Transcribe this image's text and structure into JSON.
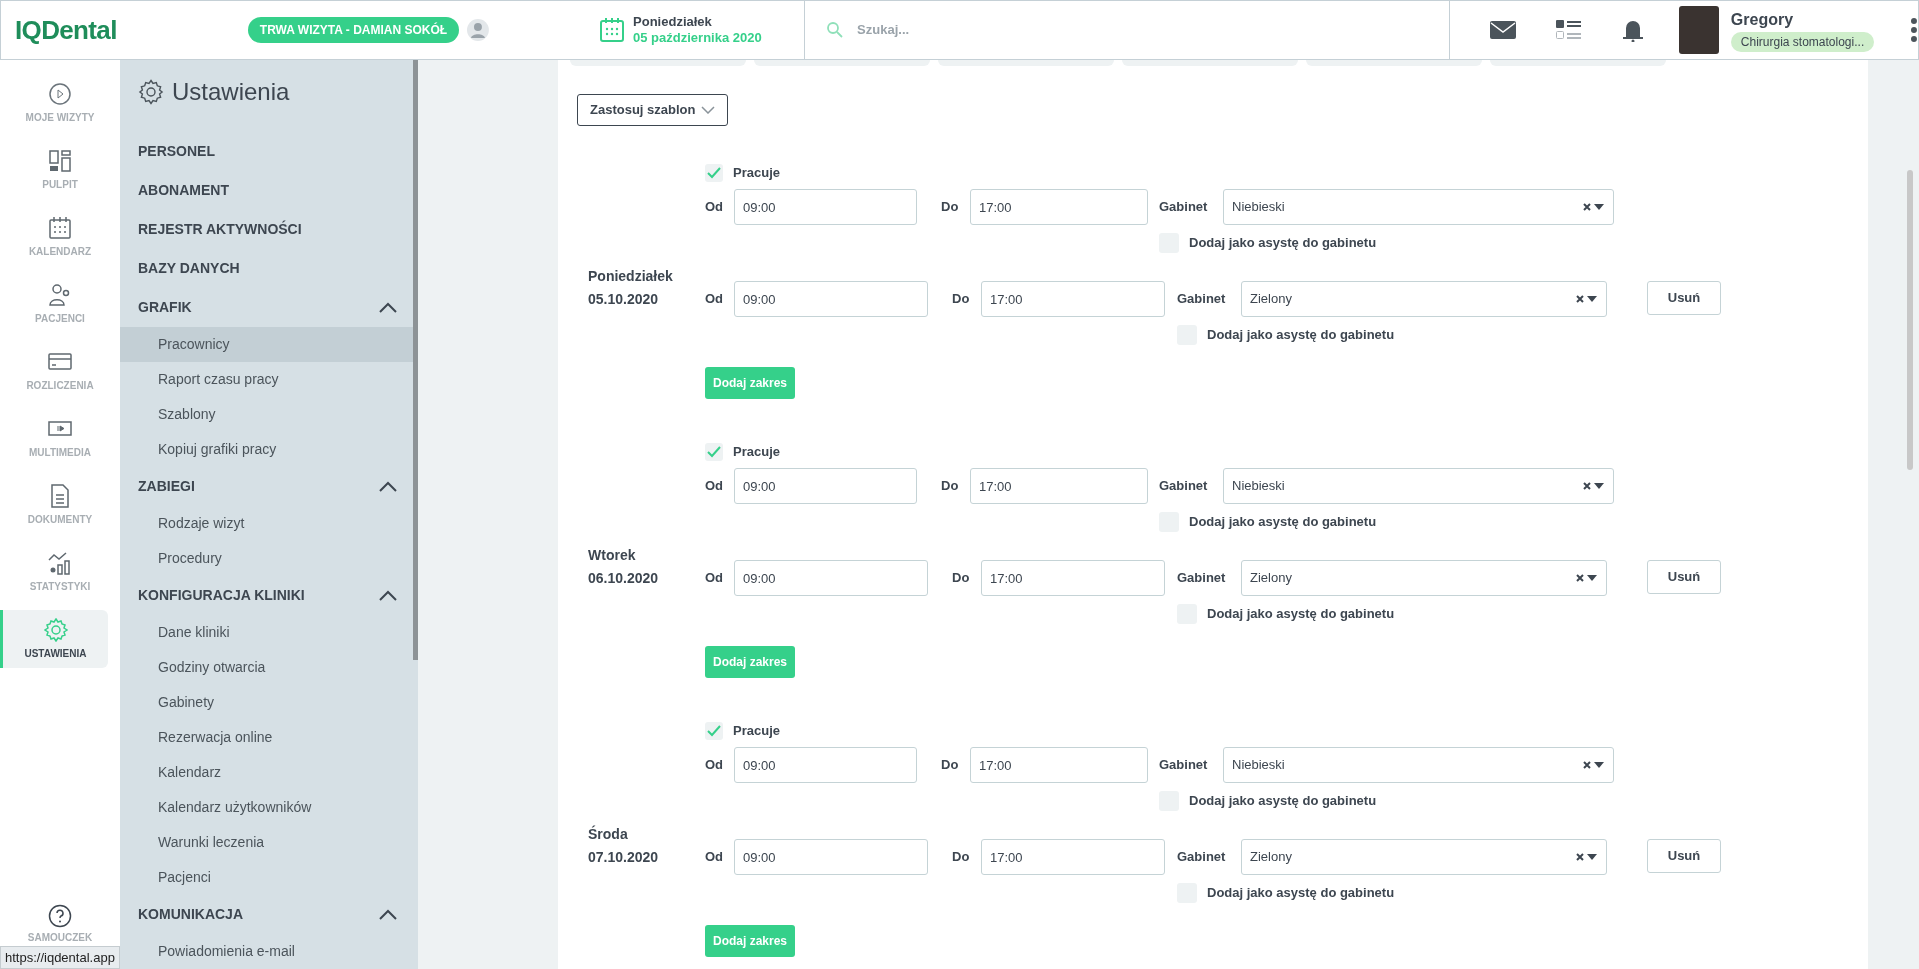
{
  "header": {
    "logo": "IQDental",
    "visit_badge": "TRWA WIZYTA - DAMIAN SOKÓŁ",
    "date_day": "Poniedziałek",
    "date_full": "05 października 2020",
    "search": {
      "placeholder": "Szukaj..."
    },
    "user": {
      "name": "Gregory",
      "role": "Chirurgia stomatologi..."
    }
  },
  "nav": [
    {
      "label": "MOJE WIZYTY",
      "selected": false
    },
    {
      "label": "PULPIT",
      "selected": false
    },
    {
      "label": "KALENDARZ",
      "selected": false
    },
    {
      "label": "PACJENCI",
      "selected": false
    },
    {
      "label": "ROZLICZENIA",
      "selected": false
    },
    {
      "label": "MULTIMEDIA",
      "selected": false
    },
    {
      "label": "DOKUMENTY",
      "selected": false
    },
    {
      "label": "STATYSTYKI",
      "selected": false
    },
    {
      "label": "USTAWIENIA",
      "selected": true
    }
  ],
  "nav_footer": {
    "label": "SAMOUCZEK"
  },
  "settings": {
    "title": "Ustawienia",
    "sections": [
      {
        "label": "PERSONEL"
      },
      {
        "label": "ABONAMENT"
      },
      {
        "label": "REJESTR AKTYWNOŚCI"
      },
      {
        "label": "BAZY DANYCH"
      },
      {
        "label": "GRAFIK",
        "expanded": true,
        "children": [
          {
            "label": "Pracownicy",
            "selected": true
          },
          {
            "label": "Raport czasu pracy",
            "selected": false
          },
          {
            "label": "Szablony",
            "selected": false
          },
          {
            "label": "Kopiuj grafiki pracy",
            "selected": false
          }
        ]
      },
      {
        "label": "ZABIEGI",
        "expanded": true,
        "children": [
          {
            "label": "Rodzaje wizyt",
            "selected": false
          },
          {
            "label": "Procedury",
            "selected": false
          }
        ]
      },
      {
        "label": "KONFIGURACJA KLINIKI",
        "expanded": true,
        "children": [
          {
            "label": "Dane kliniki",
            "selected": false
          },
          {
            "label": "Godziny otwarcia",
            "selected": false
          },
          {
            "label": "Gabinety",
            "selected": false
          },
          {
            "label": "Rezerwacja online",
            "selected": false
          },
          {
            "label": "Kalendarz",
            "selected": false
          },
          {
            "label": "Kalendarz użytkowników",
            "selected": false
          },
          {
            "label": "Warunki leczenia",
            "selected": false
          },
          {
            "label": "Pacjenci",
            "selected": false
          }
        ]
      },
      {
        "label": "KOMUNIKACJA",
        "expanded": true,
        "children": [
          {
            "label": "Powiadomienia e-mail",
            "selected": false
          }
        ]
      }
    ]
  },
  "template_button": "Zastosuj szablon",
  "days": [
    {
      "day": "Poniedziałek",
      "date": "05.10.2020",
      "works_label": "Pracuje",
      "works": true,
      "add_label": "Dodaj zakres",
      "ranges": [
        {
          "from_label": "Od",
          "from": "09:00",
          "to_label": "Do",
          "to": "17:00",
          "room_label": "Gabinet",
          "room": "Niebieski",
          "assistant_label": "Dodaj jako asystę do gabinetu",
          "assistant": false
        },
        {
          "from_label": "Od",
          "from": "09:00",
          "to_label": "Do",
          "to": "17:00",
          "room_label": "Gabinet",
          "room": "Zielony",
          "assistant_label": "Dodaj jako asystę do gabinetu",
          "assistant": false,
          "remove": "Usuń"
        }
      ]
    },
    {
      "day": "Wtorek",
      "date": "06.10.2020",
      "works_label": "Pracuje",
      "works": true,
      "add_label": "Dodaj zakres",
      "ranges": [
        {
          "from_label": "Od",
          "from": "09:00",
          "to_label": "Do",
          "to": "17:00",
          "room_label": "Gabinet",
          "room": "Niebieski",
          "assistant_label": "Dodaj jako asystę do gabinetu",
          "assistant": false
        },
        {
          "from_label": "Od",
          "from": "09:00",
          "to_label": "Do",
          "to": "17:00",
          "room_label": "Gabinet",
          "room": "Zielony",
          "assistant_label": "Dodaj jako asystę do gabinetu",
          "assistant": false,
          "remove": "Usuń"
        }
      ]
    },
    {
      "day": "Środa",
      "date": "07.10.2020",
      "works_label": "Pracuje",
      "works": true,
      "add_label": "Dodaj zakres",
      "ranges": [
        {
          "from_label": "Od",
          "from": "09:00",
          "to_label": "Do",
          "to": "17:00",
          "room_label": "Gabinet",
          "room": "Niebieski",
          "assistant_label": "Dodaj jako asystę do gabinetu",
          "assistant": false
        },
        {
          "from_label": "Od",
          "from": "09:00",
          "to_label": "Do",
          "to": "17:00",
          "room_label": "Gabinet",
          "room": "Zielony",
          "assistant_label": "Dodaj jako asystę do gabinetu",
          "assistant": false,
          "remove": "Usuń"
        }
      ]
    }
  ],
  "status_bar": {
    "url": "https://iqdental.app"
  }
}
